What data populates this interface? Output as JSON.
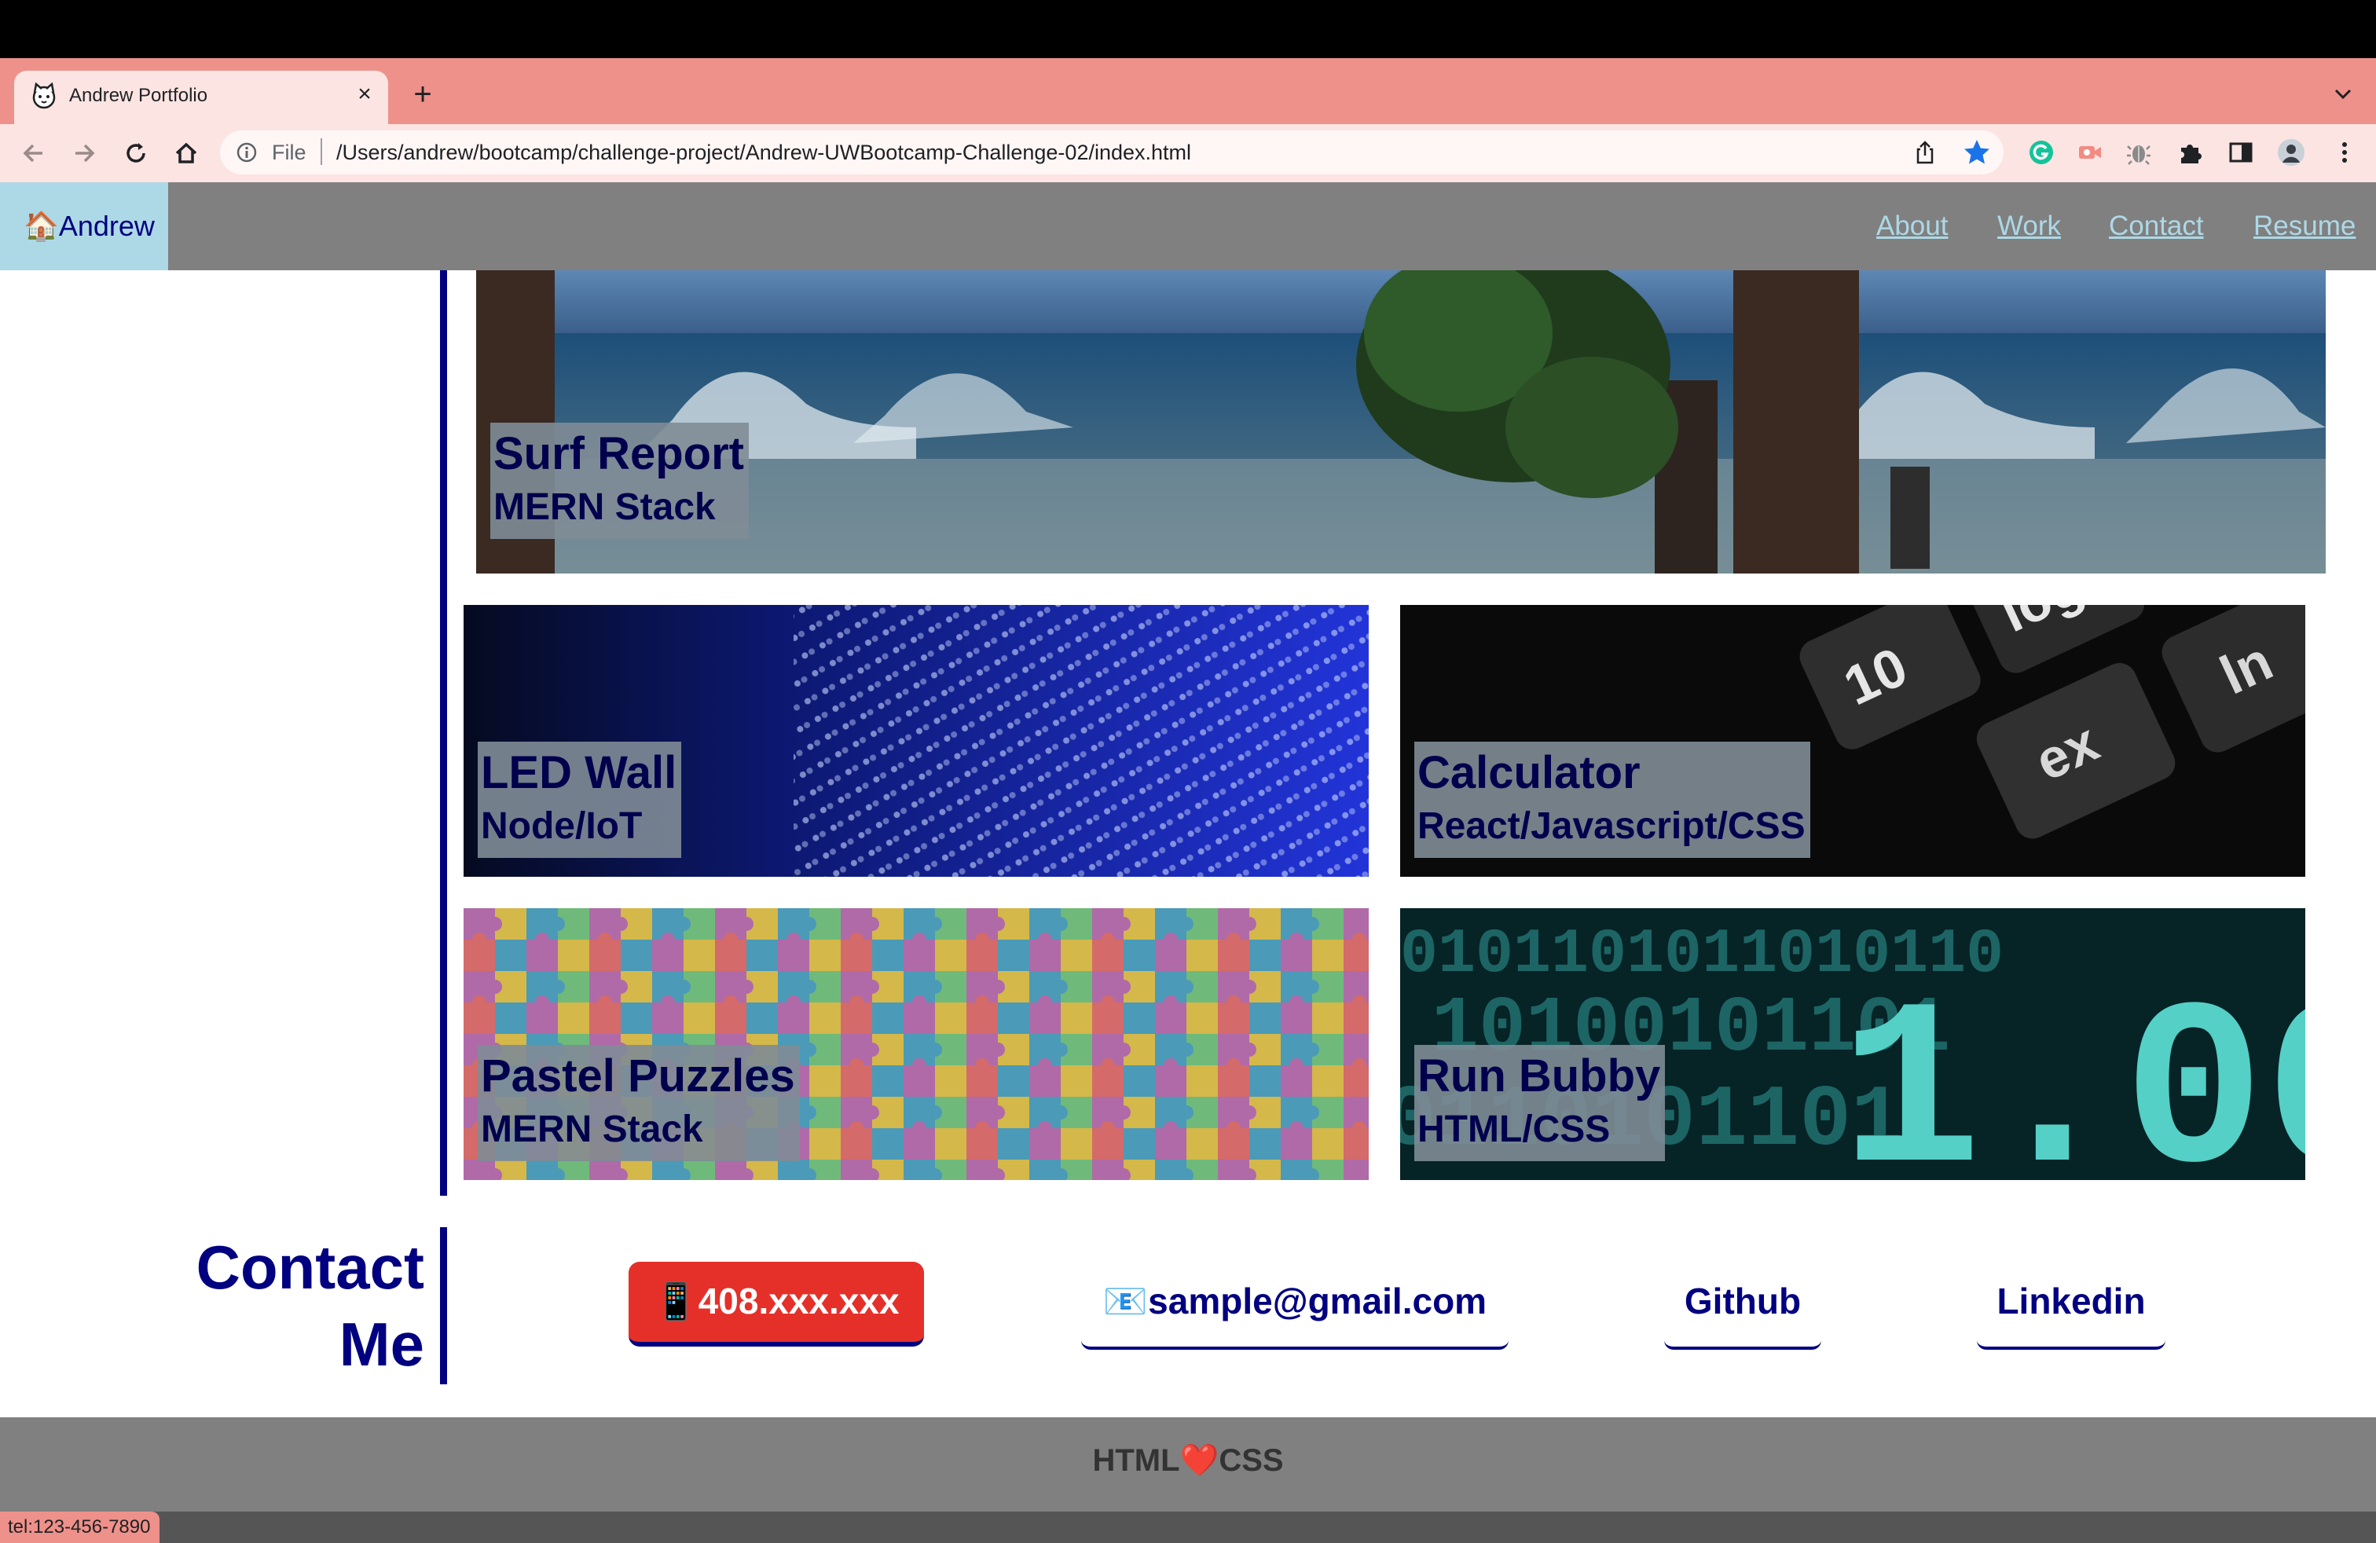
{
  "browser": {
    "tab_title": "Andrew Portfolio",
    "file_label": "File",
    "url": "/Users/andrew/bootcamp/challenge-project/Andrew-UWBootcamp-Challenge-02/index.html",
    "status_url": "tel:123-456-7890"
  },
  "site": {
    "brand": "🏠Andrew",
    "nav": [
      "About",
      "Work",
      "Contact",
      "Resume"
    ]
  },
  "work": [
    {
      "title": "Surf Report",
      "subtitle": "MERN Stack"
    },
    {
      "title": "LED Wall",
      "subtitle": "Node/IoT"
    },
    {
      "title": "Calculator",
      "subtitle": "React/Javascript/CSS"
    },
    {
      "title": "Pastel Puzzles",
      "subtitle": "MERN Stack"
    },
    {
      "title": "Run Bubby",
      "subtitle": "HTML/CSS"
    }
  ],
  "contact": {
    "heading_line1": "Contact",
    "heading_line2": "Me",
    "phone": "📱408.xxx.xxx",
    "email": "📧sample@gmail.com",
    "github": "Github",
    "linkedin": "Linkedin"
  },
  "footer": {
    "text": "HTML❤️CSS"
  },
  "colors": {
    "tab_strip": "#ee918a",
    "toolbar": "#fbe4e2",
    "nav_bg": "#808080",
    "brand_bg": "#add8e6",
    "accent_navy": "#000080",
    "phone_button": "#e5302a"
  }
}
